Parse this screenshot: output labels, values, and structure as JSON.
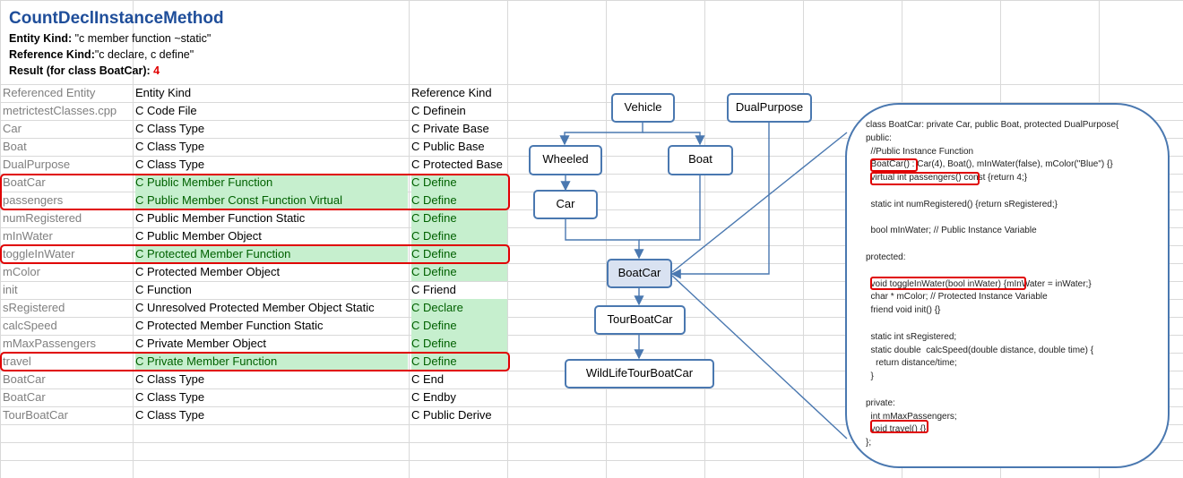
{
  "header": {
    "title": "CountDeclInstanceMethod",
    "entity_kind_label": "Entity Kind:",
    "entity_kind_value": "\"c member function ~static\"",
    "reference_kind_label": "Reference Kind:",
    "reference_kind_value": "\"c declare, c define\"",
    "result_label": "Result",
    "result_note": "(for class BoatCar):",
    "result_value": "4"
  },
  "table": {
    "columns": [
      "Referenced Entity",
      "Entity Kind",
      "Reference Kind"
    ],
    "rows": [
      {
        "entity": "metrictestClasses.cpp",
        "kind": "C Code File",
        "ref": "C Definein",
        "kind_hl": false,
        "ref_hl": false
      },
      {
        "entity": "Car",
        "kind": "C Class Type",
        "ref": "C Private Base",
        "kind_hl": false,
        "ref_hl": false
      },
      {
        "entity": "Boat",
        "kind": "C Class Type",
        "ref": "C Public Base",
        "kind_hl": false,
        "ref_hl": false
      },
      {
        "entity": "DualPurpose",
        "kind": "C Class Type",
        "ref": "C Protected Base",
        "kind_hl": false,
        "ref_hl": false
      },
      {
        "entity": "BoatCar",
        "kind": "C Public Member Function",
        "ref": "C Define",
        "kind_hl": true,
        "ref_hl": true
      },
      {
        "entity": "passengers",
        "kind": "C Public Member Const Function Virtual",
        "ref": "C Define",
        "kind_hl": true,
        "ref_hl": true
      },
      {
        "entity": "numRegistered",
        "kind": "C Public Member Function Static",
        "ref": "C Define",
        "kind_hl": false,
        "ref_hl": true
      },
      {
        "entity": "mInWater",
        "kind": "C Public Member Object",
        "ref": "C Define",
        "kind_hl": false,
        "ref_hl": true
      },
      {
        "entity": "toggleInWater",
        "kind": "C Protected Member Function",
        "ref": "C Define",
        "kind_hl": true,
        "ref_hl": true
      },
      {
        "entity": "mColor",
        "kind": "C Protected Member Object",
        "ref": "C Define",
        "kind_hl": false,
        "ref_hl": true
      },
      {
        "entity": "init",
        "kind": "C Function",
        "ref": "C Friend",
        "kind_hl": false,
        "ref_hl": false
      },
      {
        "entity": "sRegistered",
        "kind": "C Unresolved Protected Member Object Static",
        "ref": "C Declare",
        "kind_hl": false,
        "ref_hl": true
      },
      {
        "entity": "calcSpeed",
        "kind": "C Protected Member Function Static",
        "ref": "C Define",
        "kind_hl": false,
        "ref_hl": true
      },
      {
        "entity": "mMaxPassengers",
        "kind": "C Private Member Object",
        "ref": "C Define",
        "kind_hl": false,
        "ref_hl": true
      },
      {
        "entity": "travel",
        "kind": "C Private Member Function",
        "ref": "C Define",
        "kind_hl": true,
        "ref_hl": true
      },
      {
        "entity": "BoatCar",
        "kind": "C Class Type",
        "ref": "C End",
        "kind_hl": false,
        "ref_hl": false
      },
      {
        "entity": "BoatCar",
        "kind": "C Class Type",
        "ref": "C Endby",
        "kind_hl": false,
        "ref_hl": false
      },
      {
        "entity": "TourBoatCar",
        "kind": "C Class Type",
        "ref": "C Public Derive",
        "kind_hl": false,
        "ref_hl": false
      }
    ]
  },
  "diagram": {
    "nodes": {
      "vehicle": "Vehicle",
      "dualpurpose": "DualPurpose",
      "wheeled": "Wheeled",
      "boat": "Boat",
      "car": "Car",
      "boatcar": "BoatCar",
      "tourboatcar": "TourBoatCar",
      "wildlifetourboatcar": "WildLifeTourBoatCar"
    }
  },
  "code": {
    "lines": [
      "class BoatCar: private Car, public Boat, protected DualPurpose{",
      "public:",
      "  //Public Instance Function",
      "  BoatCar() : Car(4), Boat(), mInWater(false), mColor(\"Blue\") {}",
      "  virtual int passengers() const {return 4;}",
      "",
      "  static int numRegistered() {return sRegistered;}",
      "",
      "  bool mInWater; // Public Instance Variable",
      "",
      "protected:",
      "",
      "  void toggleInWater(bool inWater) {mInWater = inWater;}",
      "  char * mColor; // Protected Instance Variable",
      "  friend void init() {}",
      "",
      "  static int sRegistered;",
      "  static double  calcSpeed(double distance, double time) {",
      "    return distance/time;",
      "  }",
      "",
      "private:",
      "  int mMaxPassengers;",
      "  void travel() {}",
      "};"
    ]
  },
  "colors": {
    "title": "#1f4e9a",
    "result_value": "#e00000",
    "highlight_bg": "#c6efce",
    "highlight_text": "#006100",
    "node_border": "#4a78b0",
    "red_box": "#e00000"
  }
}
